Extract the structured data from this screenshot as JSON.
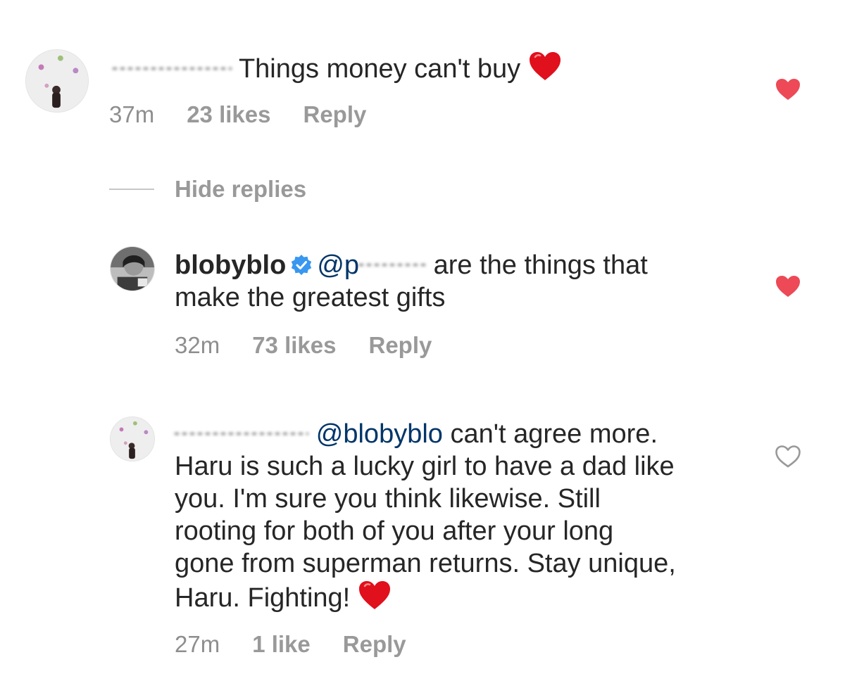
{
  "comments": [
    {
      "username": "",
      "text": "Things money can't buy",
      "time": "37m",
      "likes": "23 likes",
      "reply_label": "Reply",
      "liked": true
    },
    {
      "username": "blobyblo",
      "verified": true,
      "mention": "@p",
      "text_line1": "are the things that",
      "text_line2": "make the greatest gifts",
      "time": "32m",
      "likes": "73 likes",
      "reply_label": "Reply",
      "liked": true
    },
    {
      "username": "",
      "mention": "@blobyblo",
      "text_line1": "can't agree more.",
      "text_line2": "Haru is such a lucky girl to have a dad like",
      "text_line3": "you. I'm sure you think likewise. Still",
      "text_line4": "rooting for both of you after your long",
      "text_line5": "gone from superman returns. Stay unique,",
      "text_line6": "Haru. Fighting!",
      "time": "27m",
      "likes": "1 like",
      "reply_label": "Reply",
      "liked": false
    }
  ],
  "replies_toggle": "Hide replies",
  "colors": {
    "heart_liked": "#ed4956",
    "heart_outline": "#999999",
    "emoji_heart": "#e0101c",
    "verified": "#3897f0",
    "mention": "#003569",
    "meta": "#8e8e8e"
  }
}
